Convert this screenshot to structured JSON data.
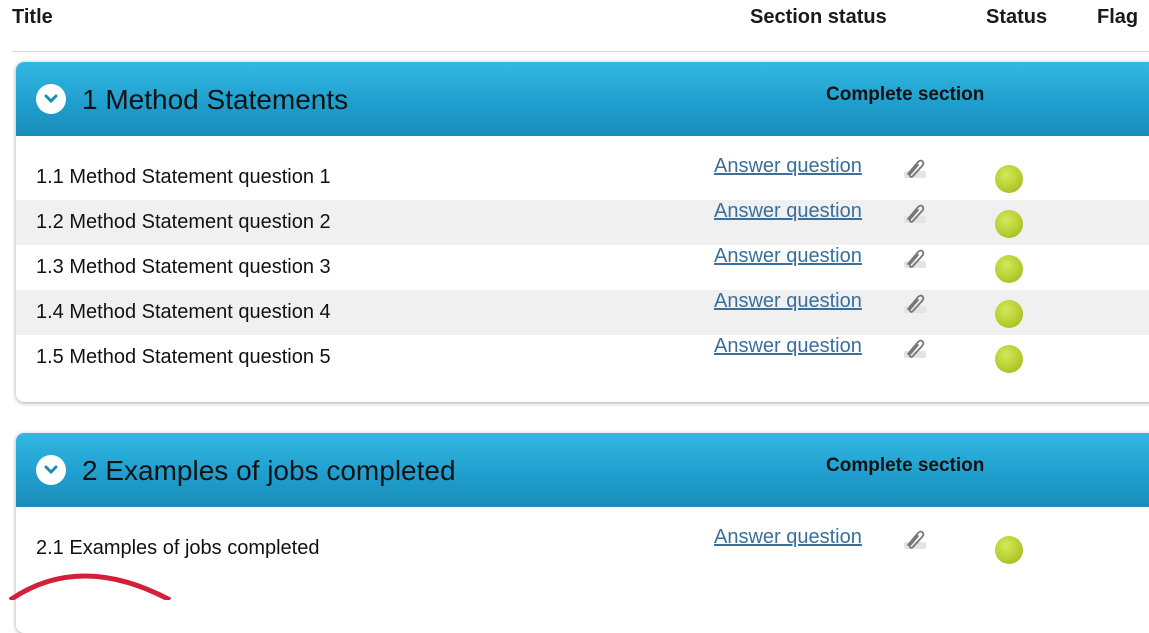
{
  "columns": {
    "title": "Title",
    "section_status": "Section status",
    "status": "Status",
    "flag": "Flag"
  },
  "sections": [
    {
      "title": "1 Method Statements",
      "action": "Complete section",
      "questions": [
        {
          "title": "1.1 Method Statement question 1",
          "link": "Answer question"
        },
        {
          "title": "1.2 Method Statement question 2",
          "link": "Answer question"
        },
        {
          "title": "1.3 Method Statement question 3",
          "link": "Answer question"
        },
        {
          "title": "1.4 Method Statement question 4",
          "link": "Answer question"
        },
        {
          "title": "1.5 Method Statement question 5",
          "link": "Answer question"
        }
      ]
    },
    {
      "title": "2 Examples of jobs completed",
      "action": "Complete section",
      "questions": [
        {
          "title": "2.1 Examples of jobs completed",
          "link": "Answer question"
        }
      ]
    }
  ],
  "colors": {
    "header_blue": "#1f9fcf",
    "status_green": "#b3cc2c",
    "link": "#3a6f9c"
  },
  "icons": {
    "toggle": "chevron-down-icon",
    "attachment": "paperclip-icon",
    "status": "status-dot"
  }
}
